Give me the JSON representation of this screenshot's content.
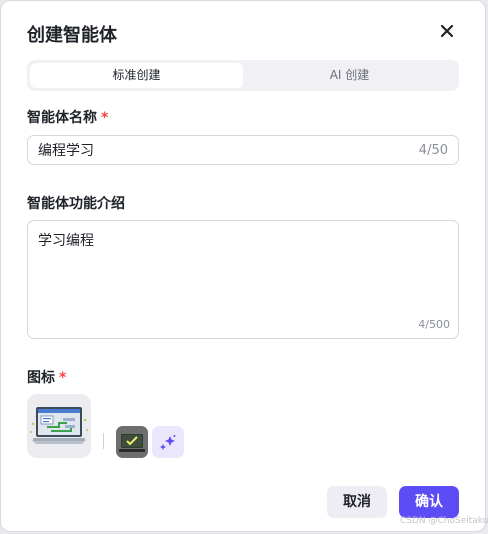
{
  "dialog": {
    "title": "创建智能体",
    "tabs": [
      {
        "label": "标准创建",
        "active": true
      },
      {
        "label": "AI 创建",
        "active": false
      }
    ]
  },
  "form": {
    "name_label": "智能体名称",
    "required_mark": "*",
    "name_value": "编程学习",
    "name_count": "4/50",
    "desc_label": "智能体功能介绍",
    "desc_value": "学习编程",
    "desc_count": "4/500",
    "icon_label": "图标"
  },
  "icons": {
    "close": "close-icon",
    "main": "laptop-code-icon",
    "thumb": "laptop-check-icon",
    "generate": "sparkle-icon"
  },
  "buttons": {
    "cancel": "取消",
    "confirm": "确认"
  },
  "watermark": "CSDN @ChoSeitaku",
  "colors": {
    "accent": "#5b4cf5",
    "required": "#f5463f",
    "generate_bg": "#ece6fd"
  }
}
